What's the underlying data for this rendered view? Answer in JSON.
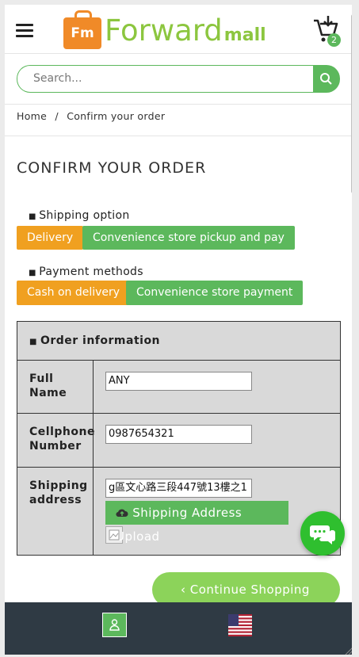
{
  "brand": {
    "logo_mark": "Fm",
    "name_main": "Forward",
    "name_sub": "mall"
  },
  "header": {
    "menu_icon": "hamburger-icon",
    "cart_icon": "cart-icon",
    "cart_count": "2"
  },
  "search": {
    "placeholder": "Search...",
    "button_icon": "search-icon"
  },
  "breadcrumb": {
    "home": "Home",
    "separator": "/",
    "current": "Confirm your order"
  },
  "page": {
    "title": "CONFIRM YOUR ORDER"
  },
  "shipping": {
    "label": "Shipping option",
    "options": [
      "Delivery",
      "Convenience store pickup and pay"
    ]
  },
  "payment": {
    "label": "Payment methods",
    "options": [
      "Cash on delivery",
      "Convenience store payment"
    ]
  },
  "order_info": {
    "heading": "Order information",
    "full_name_label_1": "Full",
    "full_name_label_2": "Name",
    "full_name_value": "ANY",
    "phone_label_1": "Cellphone",
    "phone_label_2": "Number",
    "phone_value": "0987654321",
    "address_label_1": "Shipping",
    "address_label_2": "address",
    "address_value": "g區文心路三段447號13樓之1",
    "upload_button": "Shipping Address Upload"
  },
  "actions": {
    "continue": "‹ Continue Shopping"
  },
  "colors": {
    "accent_green": "#5cb85c",
    "accent_orange": "#f0a020",
    "light_green": "#8cd35a",
    "footer": "#2f3a44"
  }
}
